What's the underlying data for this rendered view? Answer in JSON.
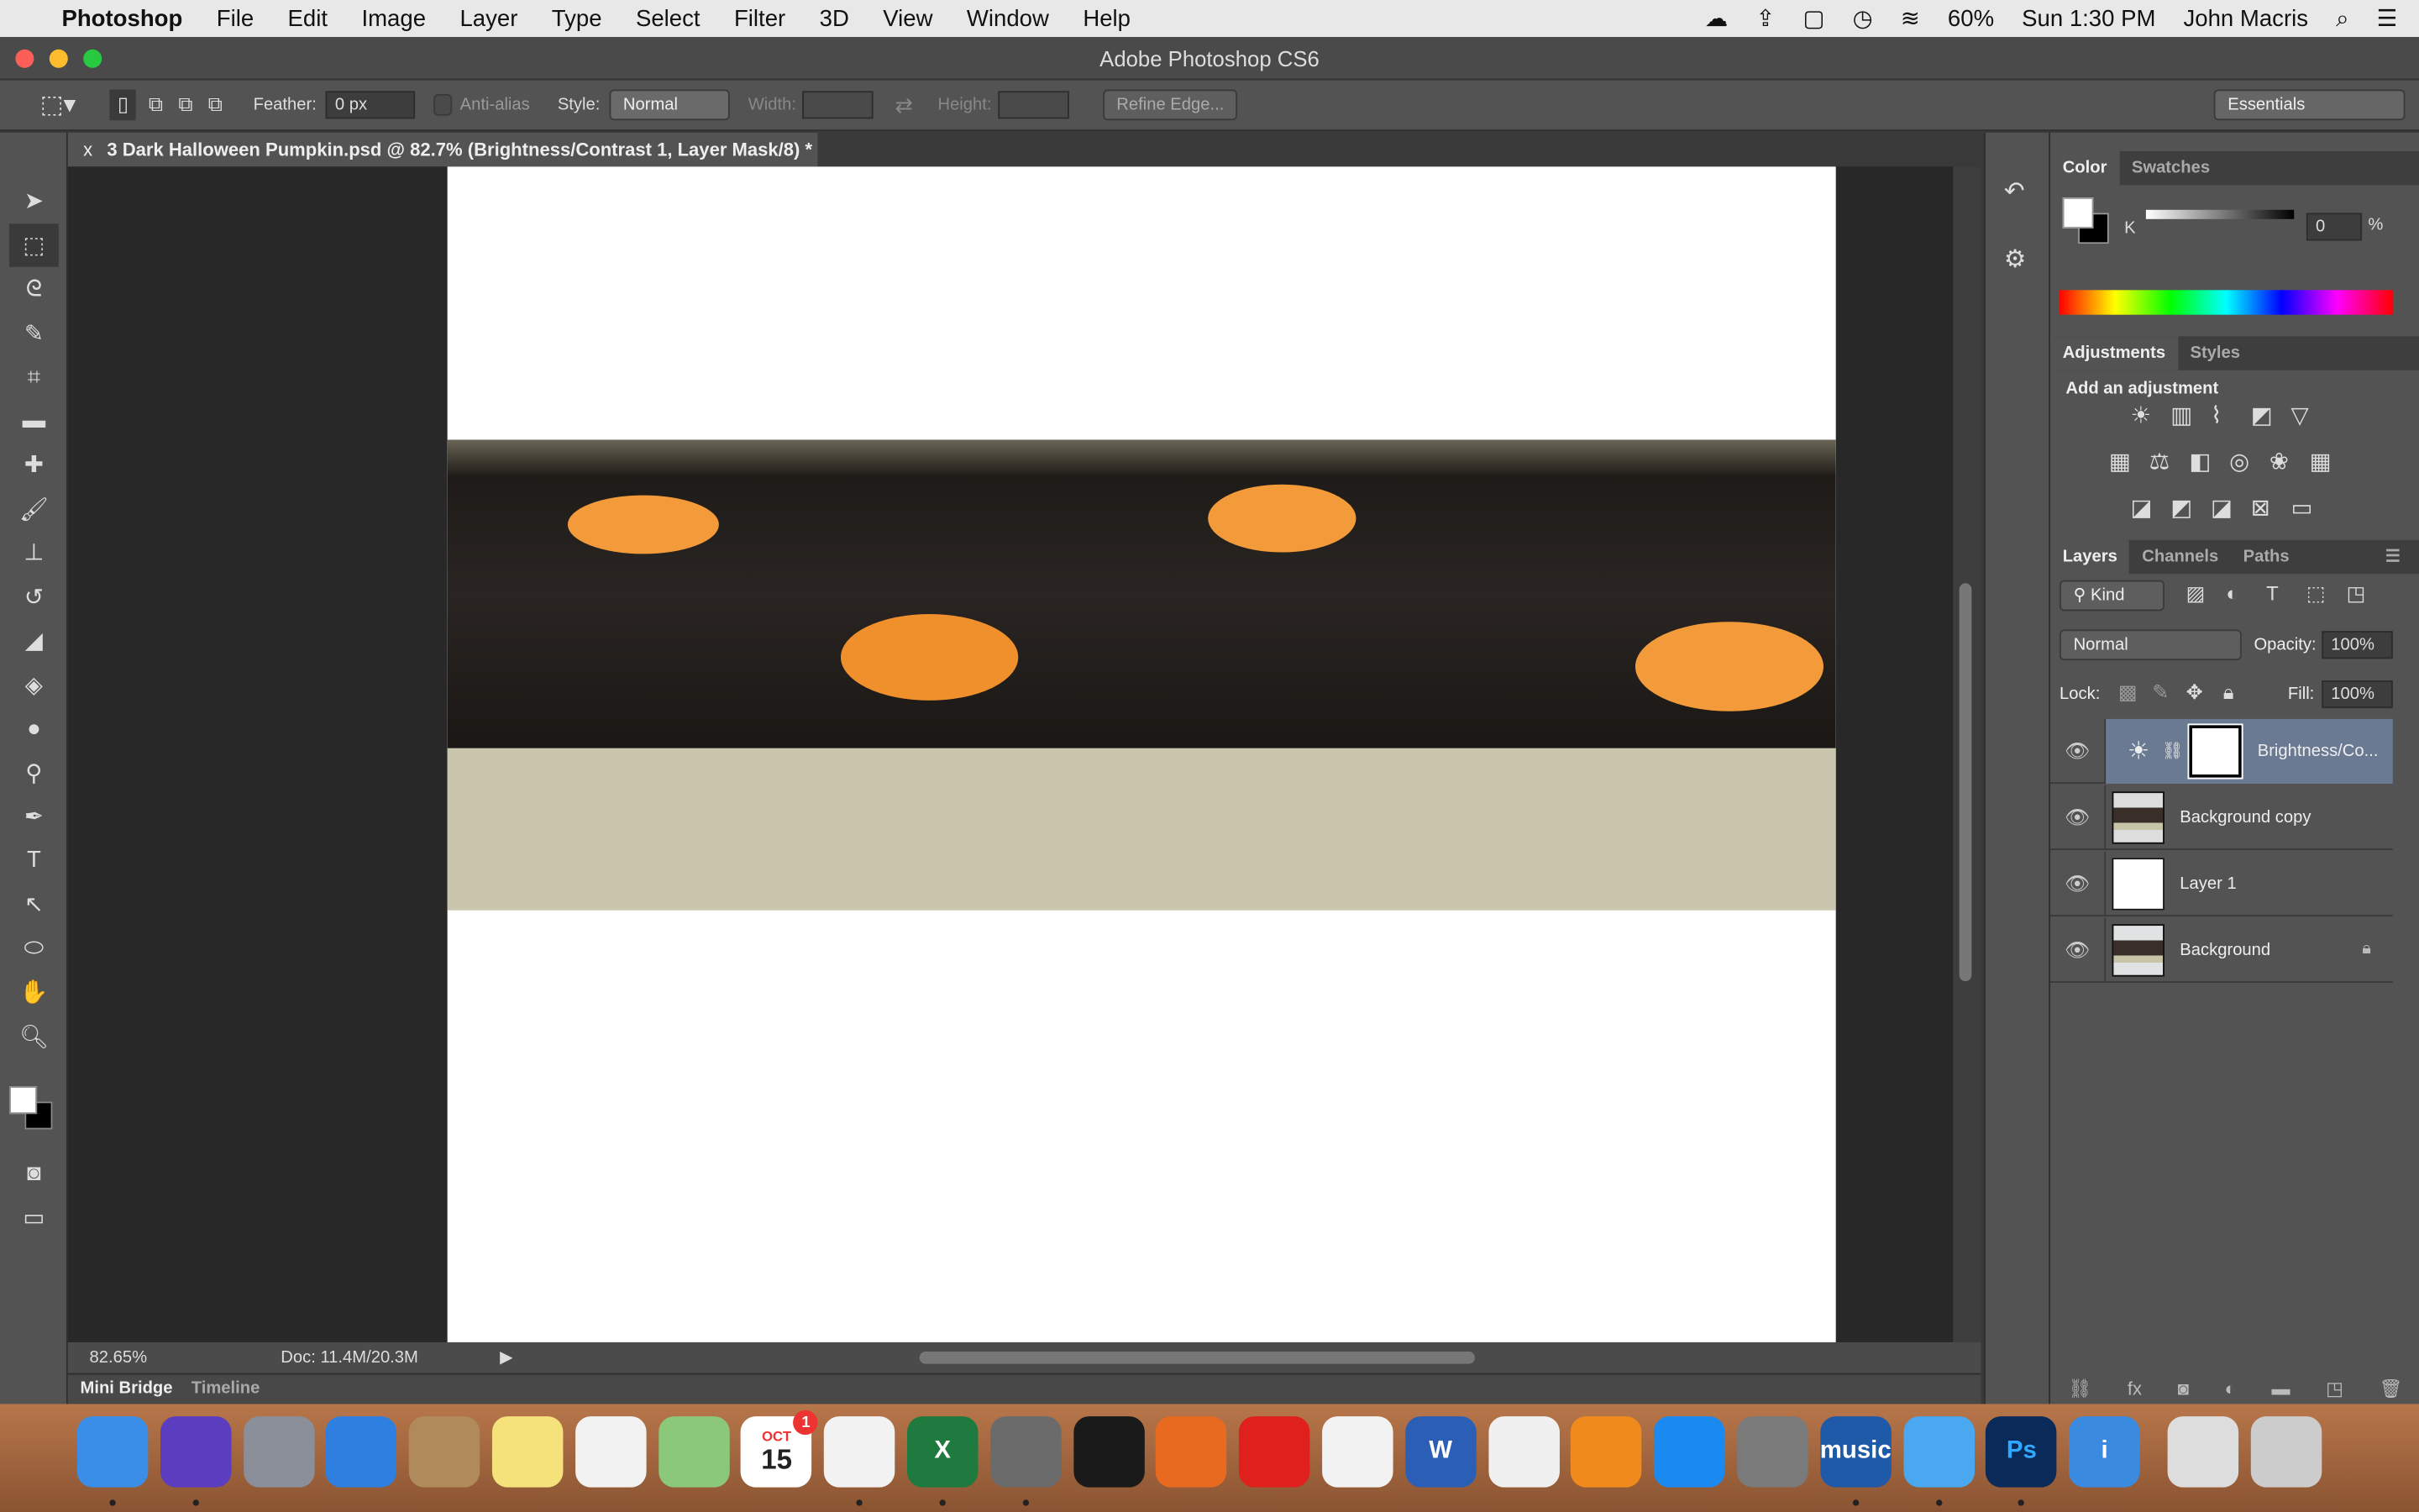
{
  "menubar": {
    "app": "Photoshop",
    "items": [
      "File",
      "Edit",
      "Image",
      "Layer",
      "Type",
      "Select",
      "Filter",
      "3D",
      "View",
      "Window",
      "Help"
    ],
    "battery": "60%",
    "clock": "Sun 1:30 PM",
    "user": "John Macris"
  },
  "window": {
    "title": "Adobe Photoshop CS6"
  },
  "options": {
    "feather_label": "Feather:",
    "feather_value": "0 px",
    "antialias": "Anti-alias",
    "style_label": "Style:",
    "style_value": "Normal",
    "width_label": "Width:",
    "height_label": "Height:",
    "refine": "Refine Edge...",
    "workspace": "Essentials"
  },
  "document": {
    "tab": "3 Dark Halloween Pumpkin.psd @ 82.7% (Brightness/Contrast 1, Layer Mask/8) *",
    "close": "x"
  },
  "status": {
    "zoom": "82.65%",
    "doc": "Doc: 11.4M/20.3M"
  },
  "bottom_tabs": [
    "Mini Bridge",
    "Timeline"
  ],
  "color_panel": {
    "tabs": [
      "Color",
      "Swatches"
    ],
    "channel": "K",
    "value": "0",
    "unit": "%"
  },
  "adjustments": {
    "tabs": [
      "Adjustments",
      "Styles"
    ],
    "heading": "Add an adjustment"
  },
  "layers_panel": {
    "tabs": [
      "Layers",
      "Channels",
      "Paths"
    ],
    "filter": "Kind",
    "blend": "Normal",
    "opacity_label": "Opacity:",
    "opacity": "100%",
    "lock_label": "Lock:",
    "fill_label": "Fill:",
    "fill": "100%",
    "layers": [
      {
        "name": "Brightness/Co...",
        "selected": true
      },
      {
        "name": "Background copy"
      },
      {
        "name": "Layer 1"
      },
      {
        "name": "Background",
        "locked": true
      }
    ]
  },
  "dock": [
    "Finder",
    "Siri",
    "Launchpad",
    "Safari",
    "Contacts",
    "Notes",
    "Reminders",
    "Maps",
    "Calendar",
    "Chrome",
    "Excel",
    "Archive",
    "QuickTime",
    "Firefox",
    "Opera",
    "Photos",
    "Word",
    "iTunes",
    "iBooks",
    "App Store",
    "System Preferences",
    "Music",
    "Messages",
    "Photoshop",
    "Info",
    "Preview",
    "Trash"
  ],
  "calendar": {
    "month": "OCT",
    "day": "15",
    "badge": "1"
  },
  "dock_labels": {
    "excel": "X",
    "word": "W",
    "music": "music",
    "ps": "Ps",
    "info": "i"
  },
  "accent": "#6a7a92"
}
